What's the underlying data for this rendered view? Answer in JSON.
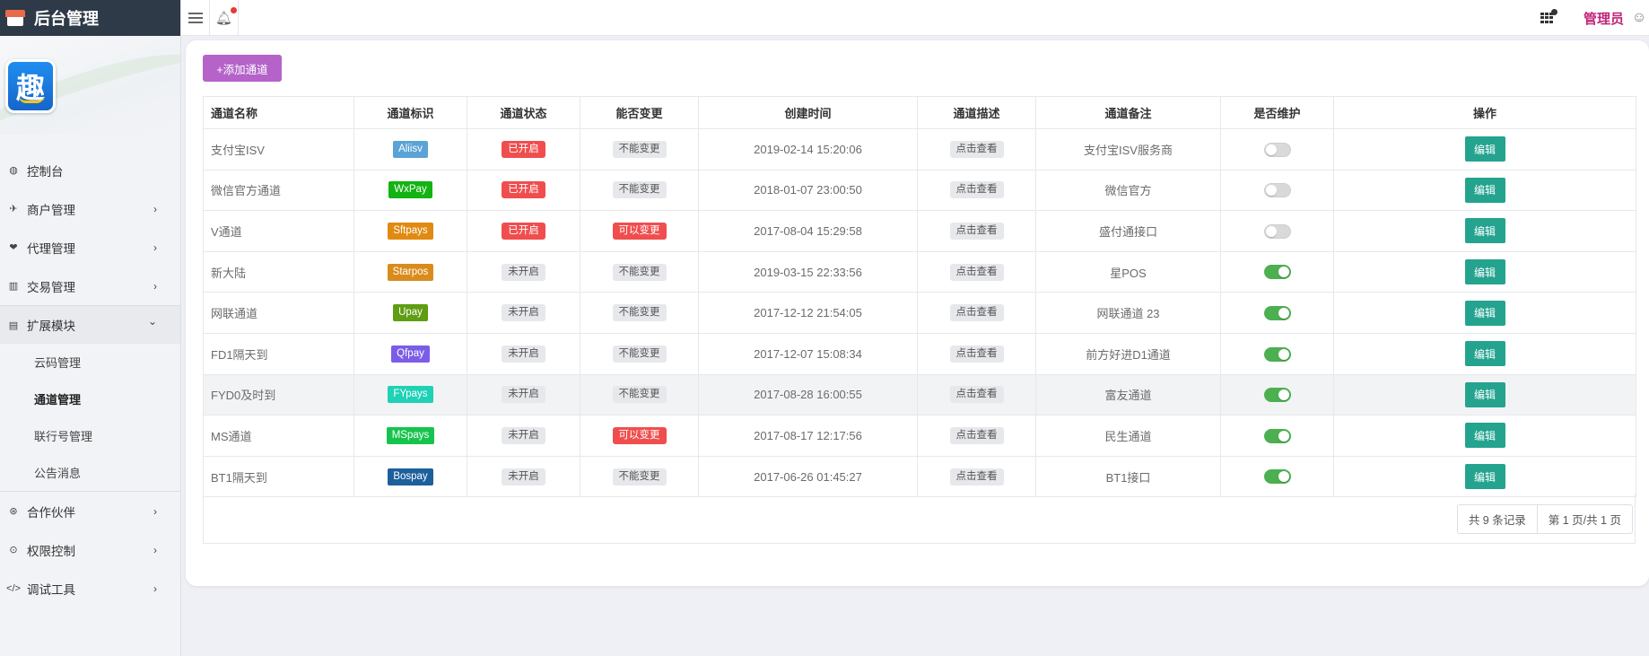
{
  "app": {
    "title": "后台管理",
    "logo_text": "趣",
    "admin_label": "管理员"
  },
  "sidebar": {
    "items": [
      {
        "label": "控制台",
        "icon": "dashboard-icon",
        "glyph": "◍",
        "has_children": false
      },
      {
        "label": "商户管理",
        "icon": "paper-plane-icon",
        "glyph": "✈",
        "has_children": true
      },
      {
        "label": "代理管理",
        "icon": "users-icon",
        "glyph": "❤",
        "has_children": true
      },
      {
        "label": "交易管理",
        "icon": "bar-chart-icon",
        "glyph": "▥",
        "has_children": true
      }
    ],
    "expanded_item": {
      "label": "扩展模块",
      "icon": "module-icon",
      "glyph": "▤"
    },
    "submenu": [
      {
        "label": "云码管理"
      },
      {
        "label": "通道管理",
        "active": true
      },
      {
        "label": "联行号管理"
      },
      {
        "label": "公告消息"
      }
    ],
    "items_after": [
      {
        "label": "合作伙伴",
        "icon": "partner-icon",
        "glyph": "⊛"
      },
      {
        "label": "权限控制",
        "icon": "shield-icon",
        "glyph": "⊙"
      },
      {
        "label": "调试工具",
        "icon": "code-icon",
        "glyph": "</>"
      }
    ]
  },
  "toolbar": {
    "add_channel_label": "+添加通道"
  },
  "table": {
    "headers": [
      "通道名称",
      "通道标识",
      "通道状态",
      "能否变更",
      "创建时间",
      "通道描述",
      "通道备注",
      "是否维护",
      "操作"
    ],
    "rows": [
      {
        "name": "支付宝ISV",
        "code": "Aliisv",
        "code_color": "#5aa3d6",
        "status": "已开启",
        "status_on": true,
        "change": "不能变更",
        "change_ok": false,
        "created": "2019-02-14 15:20:06",
        "desc": "点击查看",
        "remark": "支付宝ISV服务商",
        "maintain": false,
        "action": "编辑"
      },
      {
        "name": "微信官方通道",
        "code": "WxPay",
        "code_color": "#12b312",
        "status": "已开启",
        "status_on": true,
        "change": "不能变更",
        "change_ok": false,
        "created": "2018-01-07 23:00:50",
        "desc": "点击查看",
        "remark": "微信官方",
        "maintain": false,
        "action": "编辑"
      },
      {
        "name": "V通道",
        "code": "Sftpays",
        "code_color": "#e18a12",
        "status": "已开启",
        "status_on": true,
        "change": "可以变更",
        "change_ok": true,
        "created": "2017-08-04 15:29:58",
        "desc": "点击查看",
        "remark": "盛付通接口",
        "maintain": false,
        "action": "编辑"
      },
      {
        "name": "新大陆",
        "code": "Starpos",
        "code_color": "#d98c1d",
        "status": "未开启",
        "status_on": false,
        "change": "不能变更",
        "change_ok": false,
        "created": "2019-03-15 22:33:56",
        "desc": "点击查看",
        "remark": "星POS",
        "maintain": true,
        "action": "编辑"
      },
      {
        "name": "网联通道",
        "code": "Upay",
        "code_color": "#5f9d12",
        "status": "未开启",
        "status_on": false,
        "change": "不能变更",
        "change_ok": false,
        "created": "2017-12-12 21:54:05",
        "desc": "点击查看",
        "remark": "网联通道 23",
        "maintain": true,
        "action": "编辑"
      },
      {
        "name": "FD1隔天到",
        "code": "Qfpay",
        "code_color": "#7b5ce8",
        "status": "未开启",
        "status_on": false,
        "change": "不能变更",
        "change_ok": false,
        "created": "2017-12-07 15:08:34",
        "desc": "点击查看",
        "remark": "前方好进D1通道",
        "maintain": true,
        "action": "编辑"
      },
      {
        "name": "FYD0及时到",
        "code": "FYpays",
        "code_color": "#1fd1b5",
        "status": "未开启",
        "status_on": false,
        "change": "不能变更",
        "change_ok": false,
        "created": "2017-08-28 16:00:55",
        "desc": "点击查看",
        "remark": "富友通道",
        "maintain": true,
        "action": "编辑",
        "highlight": true
      },
      {
        "name": "MS通道",
        "code": "MSpays",
        "code_color": "#16c44d",
        "status": "未开启",
        "status_on": false,
        "change": "可以变更",
        "change_ok": true,
        "created": "2017-08-17 12:17:56",
        "desc": "点击查看",
        "remark": "民生通道",
        "maintain": true,
        "action": "编辑"
      },
      {
        "name": "BT1隔天到",
        "code": "Bospay",
        "code_color": "#1d5f9c",
        "status": "未开启",
        "status_on": false,
        "change": "不能变更",
        "change_ok": false,
        "created": "2017-06-26 01:45:27",
        "desc": "点击查看",
        "remark": "BT1接口",
        "maintain": true,
        "action": "编辑"
      }
    ]
  },
  "pagination": {
    "total_label": "共 9 条记录",
    "page_label": "第 1 页/共 1 页"
  },
  "colors": {
    "brand_bar": "#2f3a48",
    "add_button": "#b563c9",
    "edit_button": "#24a38f",
    "status_on": "#f04e4e",
    "toggle_on": "#4caf50",
    "admin_text": "#c0247a"
  }
}
